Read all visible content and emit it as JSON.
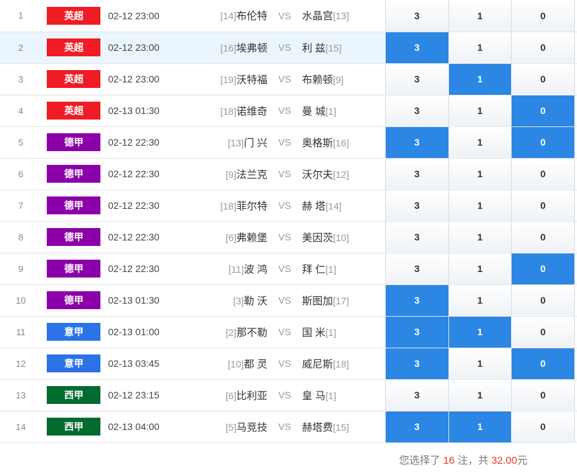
{
  "labels": {
    "vs": "VS"
  },
  "colors": {
    "league_badges": {
      "英超": "#ee1c24",
      "德甲": "#8b00a8",
      "意甲": "#2b72e6",
      "西甲": "#006b2e"
    },
    "selected_odds": "#2b86e4",
    "highlight_text": "#e53935"
  },
  "matches": [
    {
      "idx": "1",
      "league": "英超",
      "time": "02-12 23:00",
      "home_rank": "[14]",
      "home": "布伦特",
      "away": "水晶宫",
      "away_rank": "[13]",
      "odds": [
        "3",
        "1",
        "0"
      ],
      "selected": [
        false,
        false,
        false
      ]
    },
    {
      "idx": "2",
      "league": "英超",
      "time": "02-12 23:00",
      "home_rank": "[16]",
      "home": "埃弗顿",
      "away": "利 兹",
      "away_rank": "[15]",
      "odds": [
        "3",
        "1",
        "0"
      ],
      "selected": [
        true,
        false,
        false
      ]
    },
    {
      "idx": "3",
      "league": "英超",
      "time": "02-12 23:00",
      "home_rank": "[19]",
      "home": "沃特福",
      "away": "布赖顿",
      "away_rank": "[9]",
      "odds": [
        "3",
        "1",
        "0"
      ],
      "selected": [
        false,
        true,
        false
      ]
    },
    {
      "idx": "4",
      "league": "英超",
      "time": "02-13 01:30",
      "home_rank": "[18]",
      "home": "诺维奇",
      "away": "曼 城",
      "away_rank": "[1]",
      "odds": [
        "3",
        "1",
        "0"
      ],
      "selected": [
        false,
        false,
        true
      ]
    },
    {
      "idx": "5",
      "league": "德甲",
      "time": "02-12 22:30",
      "home_rank": "[13]",
      "home": "门 兴",
      "away": "奥格斯",
      "away_rank": "[16]",
      "odds": [
        "3",
        "1",
        "0"
      ],
      "selected": [
        true,
        false,
        true
      ]
    },
    {
      "idx": "6",
      "league": "德甲",
      "time": "02-12 22:30",
      "home_rank": "[9]",
      "home": "法兰克",
      "away": "沃尔夫",
      "away_rank": "[12]",
      "odds": [
        "3",
        "1",
        "0"
      ],
      "selected": [
        false,
        false,
        false
      ]
    },
    {
      "idx": "7",
      "league": "德甲",
      "time": "02-12 22:30",
      "home_rank": "[18]",
      "home": "菲尔特",
      "away": "赫 塔",
      "away_rank": "[14]",
      "odds": [
        "3",
        "1",
        "0"
      ],
      "selected": [
        false,
        false,
        false
      ]
    },
    {
      "idx": "8",
      "league": "德甲",
      "time": "02-12 22:30",
      "home_rank": "[6]",
      "home": "弗赖堡",
      "away": "美因茨",
      "away_rank": "[10]",
      "odds": [
        "3",
        "1",
        "0"
      ],
      "selected": [
        false,
        false,
        false
      ]
    },
    {
      "idx": "9",
      "league": "德甲",
      "time": "02-12 22:30",
      "home_rank": "[11]",
      "home": "波 鸿",
      "away": "拜 仁",
      "away_rank": "[1]",
      "odds": [
        "3",
        "1",
        "0"
      ],
      "selected": [
        false,
        false,
        true
      ]
    },
    {
      "idx": "10",
      "league": "德甲",
      "time": "02-13 01:30",
      "home_rank": "[3]",
      "home": "勒 沃",
      "away": "斯图加",
      "away_rank": "[17]",
      "odds": [
        "3",
        "1",
        "0"
      ],
      "selected": [
        true,
        false,
        false
      ]
    },
    {
      "idx": "11",
      "league": "意甲",
      "time": "02-13 01:00",
      "home_rank": "[2]",
      "home": "那不勒",
      "away": "国 米",
      "away_rank": "[1]",
      "odds": [
        "3",
        "1",
        "0"
      ],
      "selected": [
        true,
        true,
        false
      ]
    },
    {
      "idx": "12",
      "league": "意甲",
      "time": "02-13 03:45",
      "home_rank": "[10]",
      "home": "都 灵",
      "away": "威尼斯",
      "away_rank": "[18]",
      "odds": [
        "3",
        "1",
        "0"
      ],
      "selected": [
        true,
        false,
        true
      ]
    },
    {
      "idx": "13",
      "league": "西甲",
      "time": "02-12 23:15",
      "home_rank": "[6]",
      "home": "比利亚",
      "away": "皇 马",
      "away_rank": "[1]",
      "odds": [
        "3",
        "1",
        "0"
      ],
      "selected": [
        false,
        false,
        false
      ]
    },
    {
      "idx": "14",
      "league": "西甲",
      "time": "02-13 04:00",
      "home_rank": "[5]",
      "home": "马竞技",
      "away": "赫塔费",
      "away_rank": "[15]",
      "odds": [
        "3",
        "1",
        "0"
      ],
      "selected": [
        true,
        true,
        false
      ]
    }
  ],
  "summary": {
    "prefix": "您选择了",
    "count": "16",
    "mid": "注，共",
    "amount": "32.00",
    "suffix": "元"
  }
}
